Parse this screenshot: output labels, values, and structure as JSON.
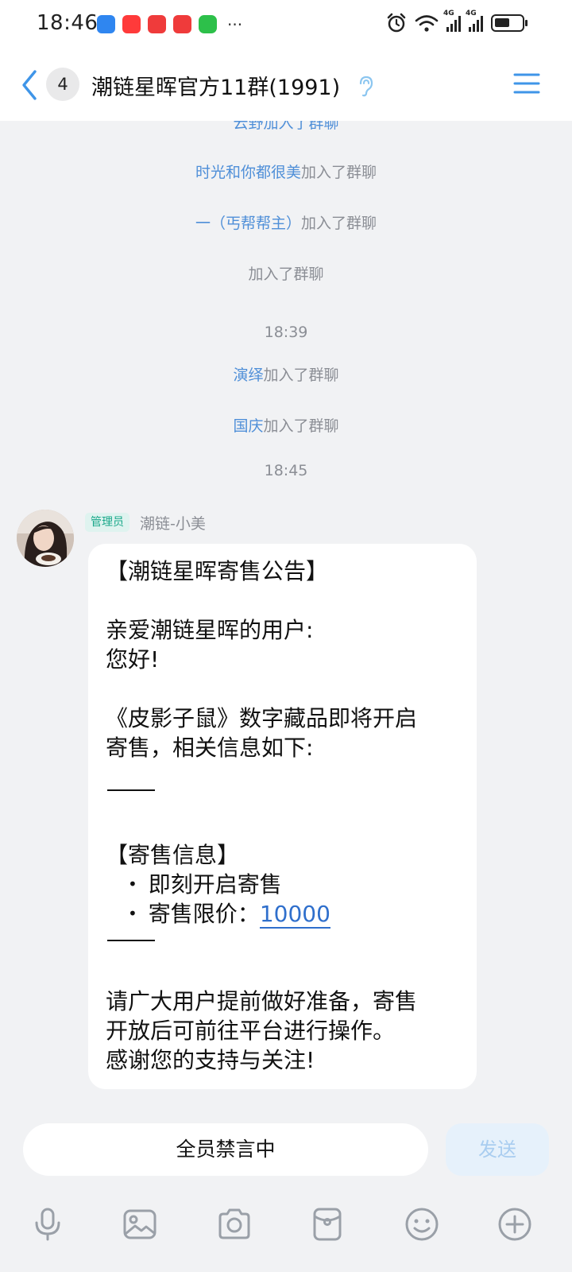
{
  "status_bar": {
    "time": "18:46",
    "notification_icons": [
      {
        "name": "weather-app-icon",
        "color": "#2f86f0"
      },
      {
        "name": "video-app-icon",
        "color": "#ff3a3a"
      },
      {
        "name": "news-app-icon",
        "color": "#ef3b3b"
      },
      {
        "name": "news-app-icon-2",
        "color": "#ef3b3b"
      },
      {
        "name": "wechat-icon",
        "color": "#2dc04a"
      }
    ],
    "more": "···",
    "signal_1_tag": "4G",
    "signal_2_tag": "4G"
  },
  "header": {
    "unread_count": "4",
    "title": "潮链星晖官方11群(1991)",
    "accent": "#3f95e8"
  },
  "messages": {
    "join_suffix": "加入了群聊",
    "partial_top": "云野加入了群聊",
    "join_1_name": "时光和你都很美",
    "join_2_name": "一（丐帮帮主）",
    "join_3_text": "加入了群聊",
    "time_1": "18:39",
    "join_4_name": "演绎",
    "join_5_name": "国庆",
    "time_2": "18:45"
  },
  "post": {
    "sender_badge": "管理员",
    "sender_name": "潮链-小美",
    "line_1": "【潮链星晖寄售公告】",
    "line_2": "亲爱潮链星晖的用户:",
    "line_3": "您好!",
    "line_4": "《皮影子鼠》数字藏品即将开启",
    "line_5": "寄售，相关信息如下:",
    "section_title": "【寄售信息】",
    "bullet": "•",
    "item_1": "即刻开启寄售",
    "item_2_label": "寄售限价：",
    "item_2_value": "10000",
    "line_6": "请广大用户提前做好准备，寄售",
    "line_7": "开放后可前往平台进行操作。",
    "line_8": "感谢您的支持与关注!"
  },
  "input": {
    "status_text": "全员禁言中",
    "send_label": "发送"
  },
  "toolbar": {
    "icons": [
      "microphone-icon",
      "image-icon",
      "camera-icon",
      "red-packet-icon",
      "emoji-icon",
      "plus-icon"
    ]
  }
}
